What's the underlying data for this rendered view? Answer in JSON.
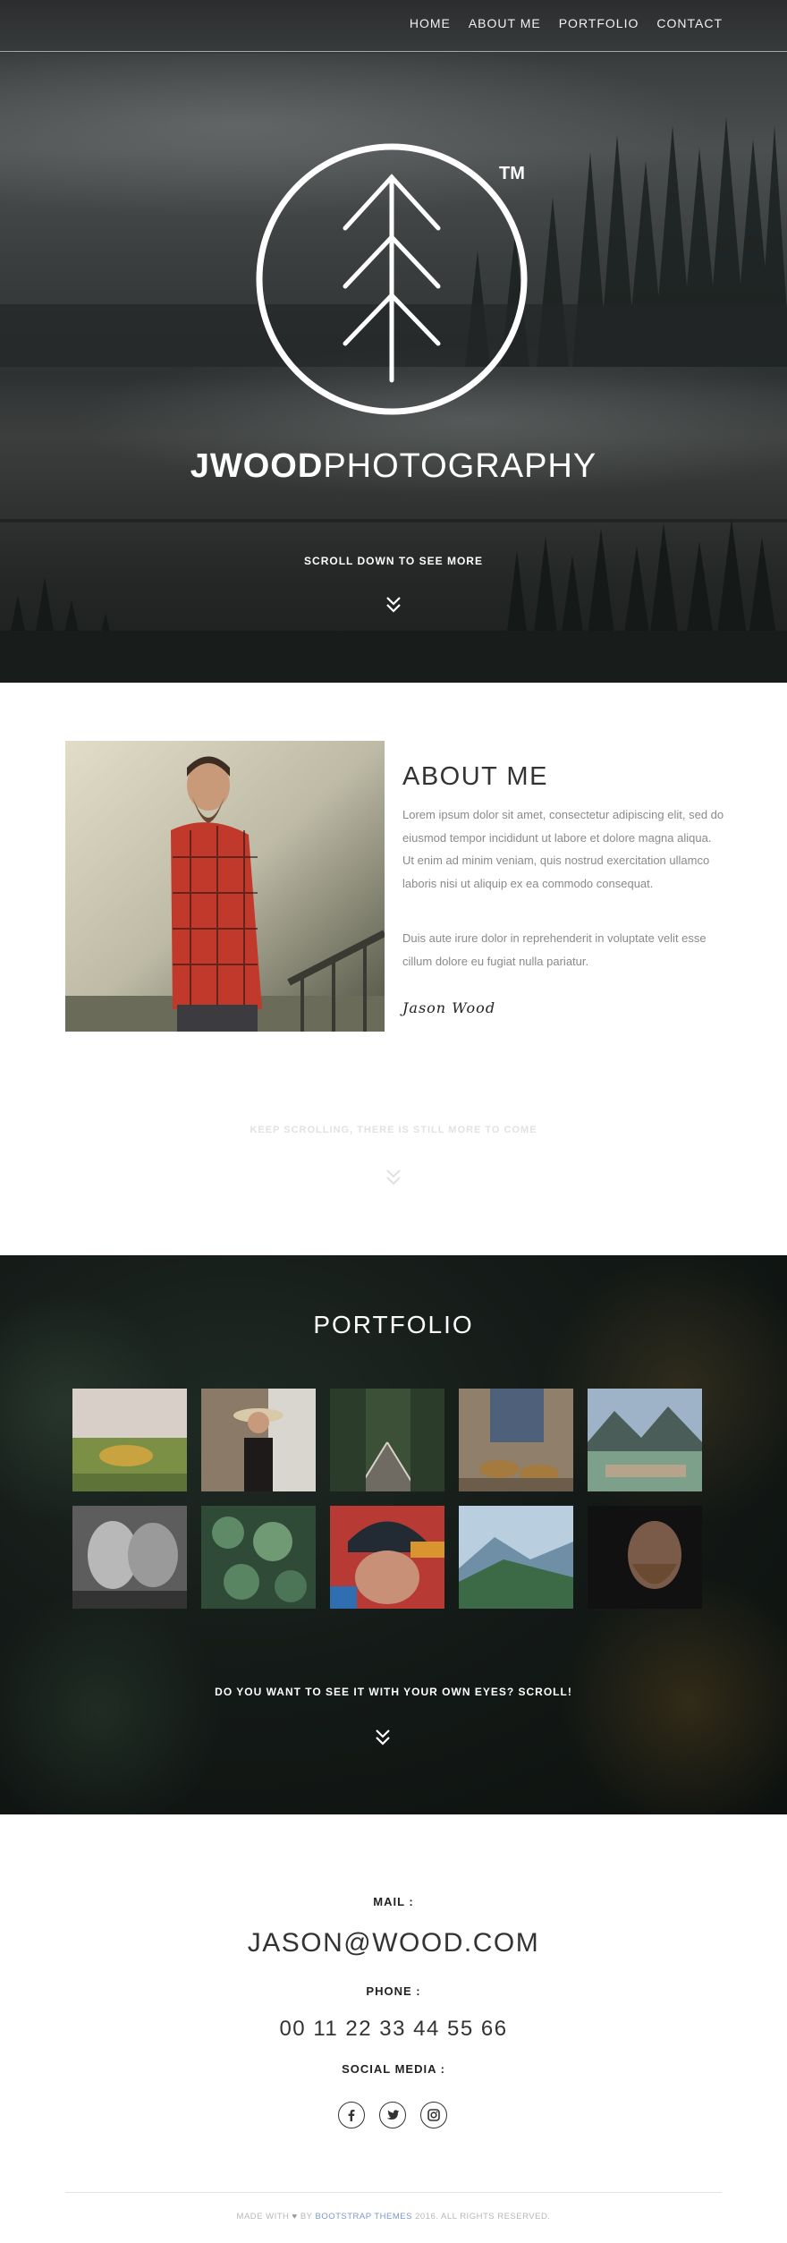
{
  "nav": {
    "items": [
      {
        "label": "HOME"
      },
      {
        "label": "ABOUT ME"
      },
      {
        "label": "PORTFOLIO"
      },
      {
        "label": "CONTACT"
      }
    ]
  },
  "hero": {
    "logo_mark": "TM",
    "brand_bold": "JWOOD",
    "brand_light": "PHOTOGRAPHY",
    "scroll_label": "SCROLL DOWN TO SEE MORE",
    "logo_icon": "pine-tree-icon",
    "scroll_icon": "double-chevron-down-icon"
  },
  "about": {
    "title": "ABOUT ME",
    "paragraph1": "Lorem ipsum dolor sit amet, consectetur adipiscing elit, sed do eiusmod tempor incididunt ut labore et dolore magna aliqua. Ut enim ad minim veniam, quis nostrud exercitation ullamco laboris nisi ut aliquip ex ea commodo consequat.",
    "paragraph2": "Duis aute irure dolor in reprehenderit in voluptate velit esse cillum dolore eu fugiat nulla pariatur.",
    "signature": "Jason Wood",
    "keep_scrolling": "KEEP SCROLLING, THERE IS STILL MORE TO COME"
  },
  "portfolio": {
    "title": "PORTFOLIO",
    "label": "DO YOU WANT TO SEE IT WITH YOUR OWN EYES? SCROLL!"
  },
  "contact": {
    "mail_label": "MAIL :",
    "mail_value": "JASON@WOOD.COM",
    "phone_label": "PHONE :",
    "phone_value": "00 11 22 33 44 55 66",
    "social_label": "SOCIAL MEDIA :",
    "social_icons": [
      "facebook-icon",
      "twitter-icon",
      "instagram-icon"
    ]
  },
  "footer": {
    "prefix": "MADE WITH",
    "by": "BY",
    "link": "BOOTSTRAP THEMES",
    "suffix": "2016. ALL RIGHTS RESERVED."
  },
  "colors": {
    "accent_link": "#7d99c8",
    "text_dark": "#333333",
    "text_muted": "#8a8a8a"
  }
}
